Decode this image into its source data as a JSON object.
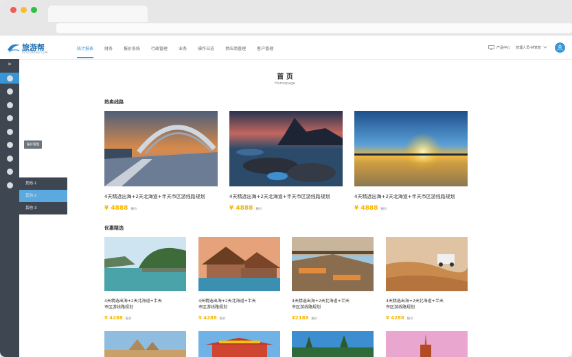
{
  "app": {
    "logo_text": "旅游帮",
    "logo_sub": "LVYOUBANG.COM"
  },
  "nav": [
    {
      "label": "统计报表",
      "active": true
    },
    {
      "label": "财务"
    },
    {
      "label": "报价系统"
    },
    {
      "label": "行政管理"
    },
    {
      "label": "业务"
    },
    {
      "label": "操作日志"
    },
    {
      "label": "供应商管理"
    },
    {
      "label": "客户管理"
    }
  ],
  "header_tools": {
    "product_center": "产品中心",
    "user": "管理人员-林管管"
  },
  "sidebar": {
    "tooltip": "报价管理",
    "submenu": [
      "其他-1",
      "其他-2",
      "其他-3"
    ]
  },
  "page": {
    "title": "首 页",
    "subtitle": "Homepage"
  },
  "hot": {
    "title": "热卖线路",
    "cards": [
      {
        "title": "4天精选出海+2天北海道+半天市区游线路规划",
        "price": "¥ 4888",
        "tag": "报价"
      },
      {
        "title": "4天精选出海+2天北海道+半天市区游线路规划",
        "price": "¥ 4888",
        "tag": "报价"
      },
      {
        "title": "4天精选出海+2天北海道+半天市区游线路规划",
        "price": "¥ 4888",
        "tag": "报价"
      }
    ]
  },
  "deals": {
    "title": "优惠精选",
    "cards": [
      {
        "line1": "4天精选出海+2天北海道+半天",
        "line2": "市区游线路规划",
        "price": "¥ 4288",
        "tag": "报价"
      },
      {
        "line1": "4天精选出海+2天北海道+半天",
        "line2": "市区游线路规划",
        "price": "¥ 4288",
        "tag": "报价"
      },
      {
        "line1": "4天精选出海+2天北海道+半天",
        "line2": "市区游线路规划",
        "price": "¥2188",
        "tag": "报价"
      },
      {
        "line1": "4天精选出海+2天北海道+半天",
        "line2": "市区游线路规划",
        "price": "¥ 4288",
        "tag": "报价"
      }
    ]
  },
  "colors": {
    "accent": "#3a95d4",
    "price": "#f7b500",
    "sidebar": "#3e4751"
  }
}
